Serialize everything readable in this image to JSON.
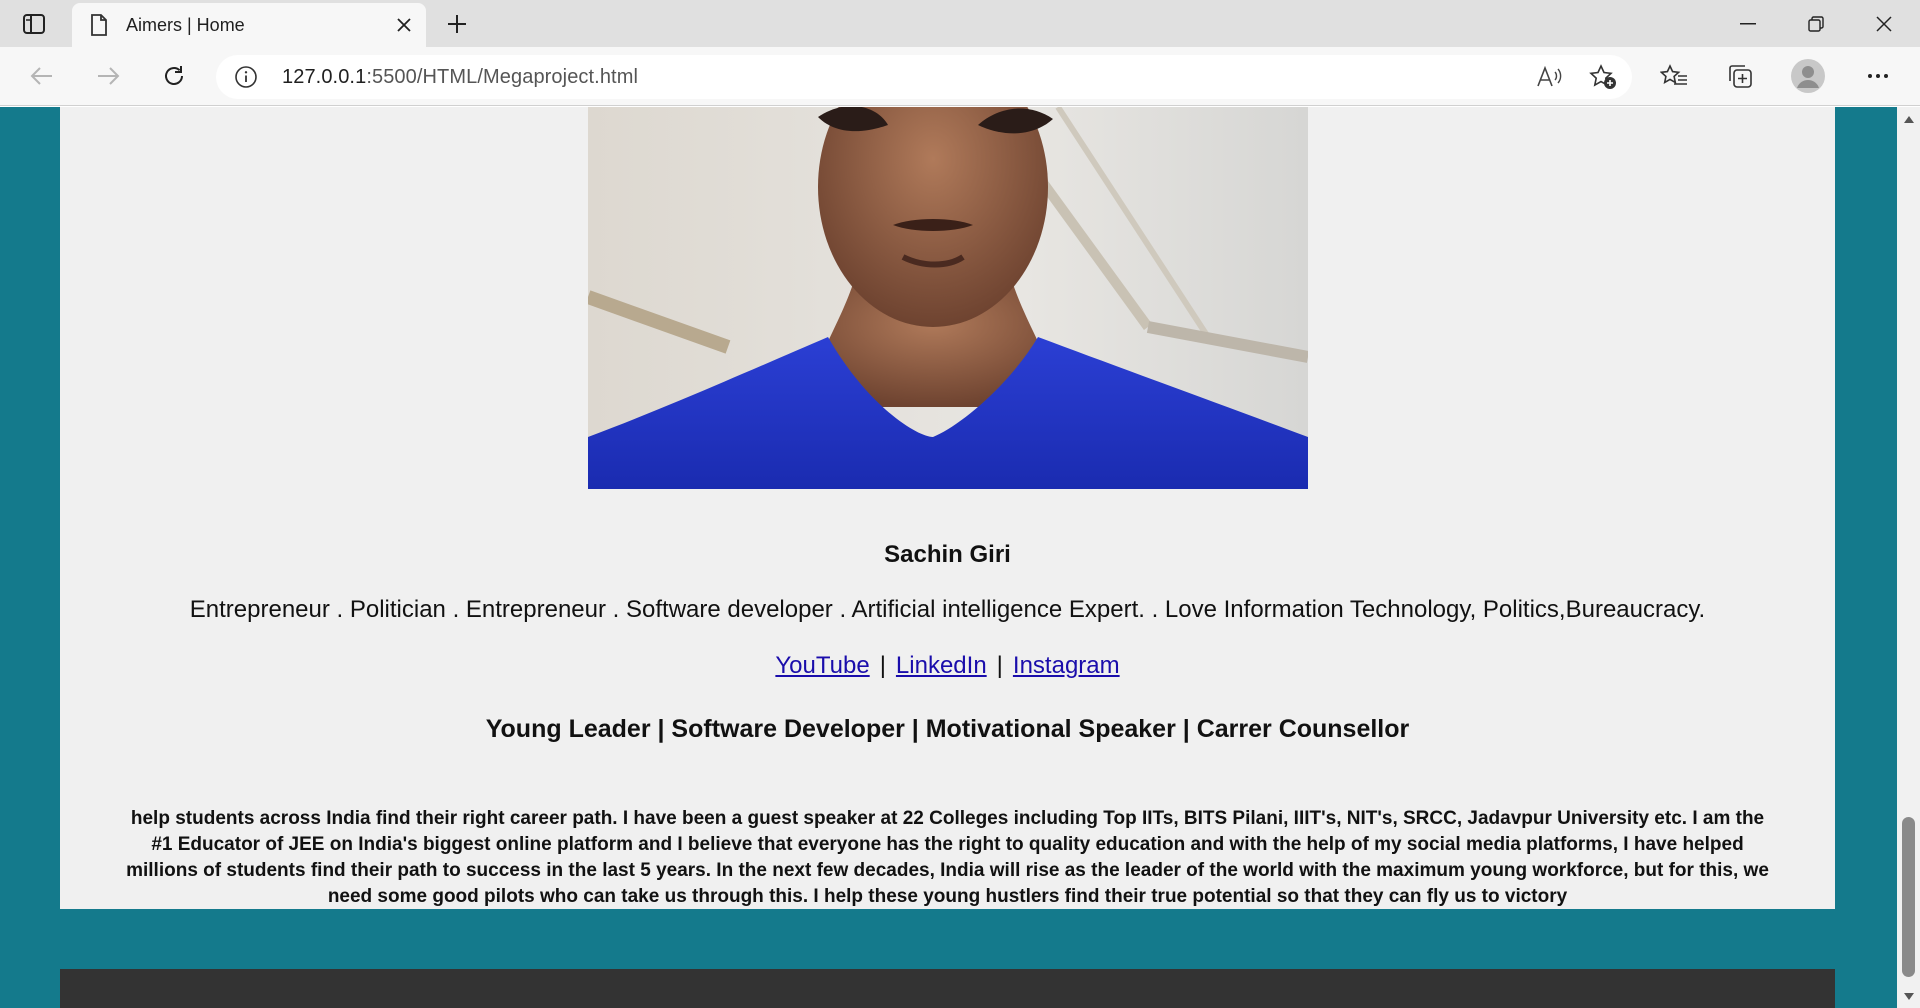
{
  "browser": {
    "tab_title": "Aimers | Home",
    "url_host": "127.0.0.1",
    "url_path": ":5500/HTML/Megaproject.html"
  },
  "profile": {
    "name": "Sachin Giri",
    "tagline": "Entrepreneur . Politician . Entrepreneur . Software developer . Artificial intelligence Expert. . Love Information Technology, Politics,Bureaucracy.",
    "links": [
      {
        "label": "YouTube"
      },
      {
        "label": "LinkedIn"
      },
      {
        "label": "Instagram"
      }
    ],
    "separator": "|",
    "roles": "Young Leader | Software Developer | Motivational Speaker | Carrer Counsellor",
    "bio": "help students across India find their right career path. I have been a guest speaker at 22 Colleges including Top IITs, BITS Pilani, IIIT's, NIT's, SRCC, Jadavpur University etc. I am the #1 Educator of JEE on India's biggest online platform and I believe that everyone has the right to quality education and with the help of my social media platforms, I have helped millions of students find their path to success in the last 5 years. In the next few decades, India will rise as the leader of the world with the maximum young workforce, but for this, we need some good pilots who can take us through this. I help these young hustlers find their true potential so that they can fly us to victory"
  },
  "colors": {
    "page_background": "#147a8c",
    "card_background": "#f0f0f0",
    "footer_background": "#333333",
    "link": "#1a0dab"
  }
}
